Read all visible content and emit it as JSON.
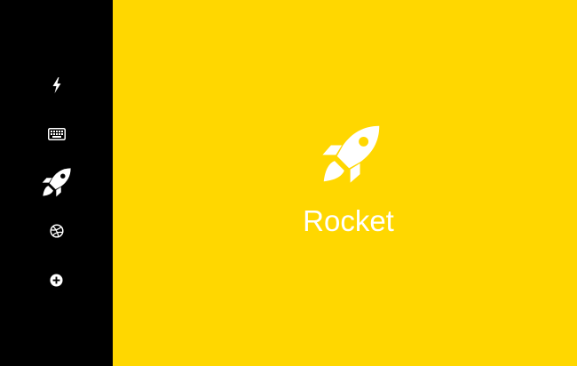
{
  "colors": {
    "sidebar_bg": "#000000",
    "main_bg": "#FFD700",
    "icon_color": "#ffffff"
  },
  "sidebar": {
    "items": [
      {
        "icon": "bolt-icon",
        "active": false
      },
      {
        "icon": "keyboard-icon",
        "active": false
      },
      {
        "icon": "rocket-icon",
        "active": true
      },
      {
        "icon": "dribbble-icon",
        "active": false
      },
      {
        "icon": "plus-circle-icon",
        "active": false
      }
    ]
  },
  "main": {
    "icon": "rocket-icon",
    "title": "Rocket"
  }
}
